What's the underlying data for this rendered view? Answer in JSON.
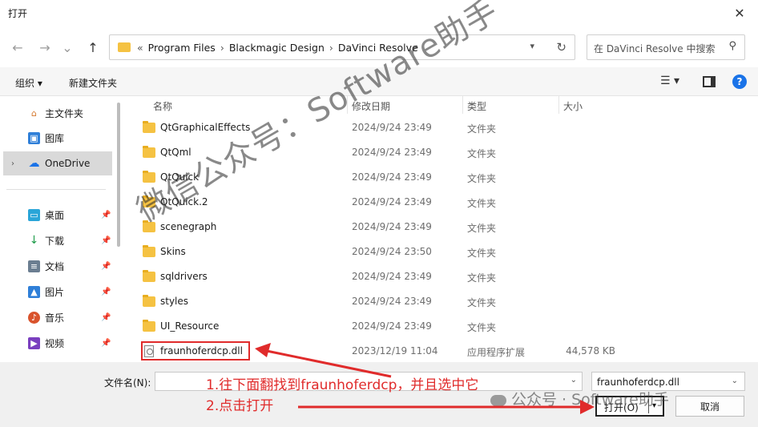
{
  "window": {
    "title": "打开",
    "close_glyph": "✕"
  },
  "nav": {
    "back_glyph": "←",
    "forward_glyph": "→",
    "recent_glyph": "⌄",
    "up_glyph": "↑",
    "breadcrumb_prefix": "«",
    "breadcrumbs": [
      "Program Files",
      "Blackmagic Design",
      "DaVinci Resolve"
    ],
    "crumb_sep": "›",
    "search_placeholder": "在 DaVinci Resolve 中搜索"
  },
  "toolbar": {
    "organize": "组织 ▾",
    "new_folder": "新建文件夹"
  },
  "sidebar": {
    "items": [
      {
        "label": "主文件夹",
        "icon": "home-icon"
      },
      {
        "label": "图库",
        "icon": "gallery-icon"
      },
      {
        "label": "OneDrive",
        "icon": "cloud-icon",
        "selected": true
      },
      {
        "label": "桌面",
        "icon": "desktop-icon",
        "pinned": true
      },
      {
        "label": "下载",
        "icon": "download-icon",
        "pinned": true
      },
      {
        "label": "文档",
        "icon": "document-icon",
        "pinned": true
      },
      {
        "label": "图片",
        "icon": "picture-icon",
        "pinned": true
      },
      {
        "label": "音乐",
        "icon": "music-icon",
        "pinned": true
      },
      {
        "label": "视频",
        "icon": "video-icon",
        "pinned": true
      }
    ]
  },
  "columns": {
    "name": "名称",
    "date": "修改日期",
    "type": "类型",
    "size": "大小"
  },
  "files": [
    {
      "name": "QtGraphicalEffects",
      "date": "2024/9/24 23:49",
      "type": "文件夹",
      "size": "",
      "kind": "folder"
    },
    {
      "name": "QtQml",
      "date": "2024/9/24 23:49",
      "type": "文件夹",
      "size": "",
      "kind": "folder"
    },
    {
      "name": "QtQuick",
      "date": "2024/9/24 23:49",
      "type": "文件夹",
      "size": "",
      "kind": "folder"
    },
    {
      "name": "QtQuick.2",
      "date": "2024/9/24 23:49",
      "type": "文件夹",
      "size": "",
      "kind": "folder"
    },
    {
      "name": "scenegraph",
      "date": "2024/9/24 23:49",
      "type": "文件夹",
      "size": "",
      "kind": "folder"
    },
    {
      "name": "Skins",
      "date": "2024/9/24 23:50",
      "type": "文件夹",
      "size": "",
      "kind": "folder"
    },
    {
      "name": "sqldrivers",
      "date": "2024/9/24 23:49",
      "type": "文件夹",
      "size": "",
      "kind": "folder"
    },
    {
      "name": "styles",
      "date": "2024/9/24 23:49",
      "type": "文件夹",
      "size": "",
      "kind": "folder"
    },
    {
      "name": "UI_Resource",
      "date": "2024/9/24 23:49",
      "type": "文件夹",
      "size": "",
      "kind": "folder"
    },
    {
      "name": "fraunhoferdcp.dll",
      "date": "2023/12/19 11:04",
      "type": "应用程序扩展",
      "size": "44,578 KB",
      "kind": "dll"
    }
  ],
  "footer": {
    "filename_label": "文件名(N):",
    "filename_value": "",
    "filter_value": "fraunhoferdcp.dll",
    "open_button": "打开(O)",
    "cancel_button": "取消"
  },
  "annotations": {
    "step1": "1.往下面翻找到fraunhoferdcp，并且选中它",
    "step2": "2.点击打开"
  },
  "watermarks": {
    "diagonal": "微信公众号：Software助手",
    "footer": "公众号 · Software助手"
  },
  "colors": {
    "annotation": "#e02b2b",
    "folder": "#f5c242",
    "accent": "#1a73e8"
  }
}
